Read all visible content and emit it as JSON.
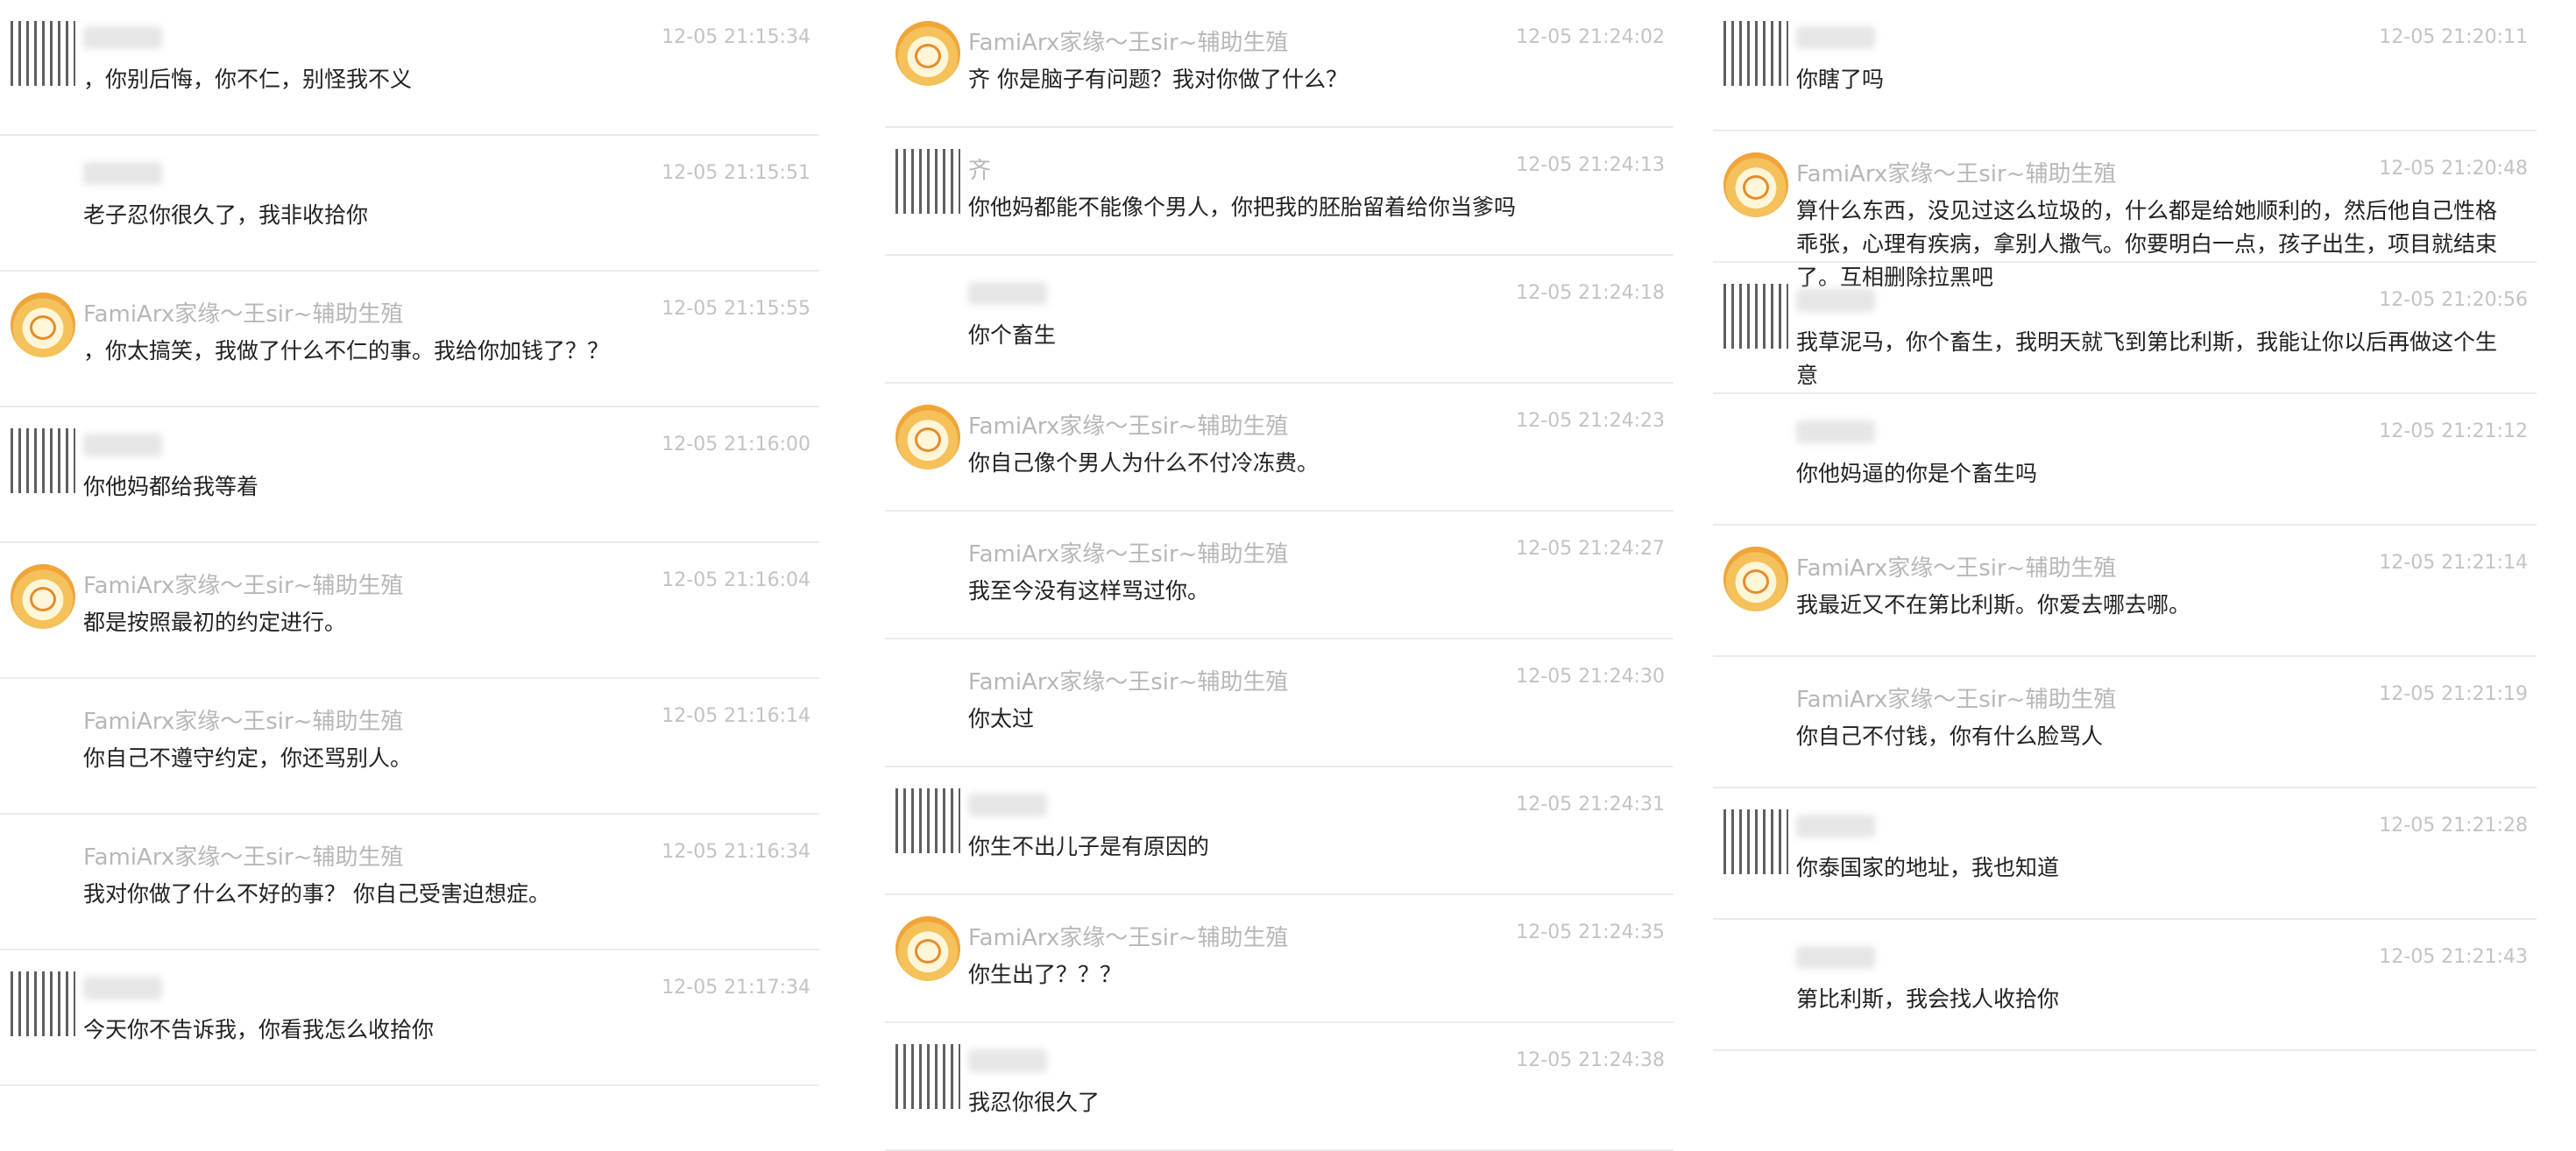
{
  "columns": [
    {
      "messages": [
        {
          "sender": "",
          "time": "12-05 21:15:34",
          "text": "，你别后悔，你不仁，别怪我不义",
          "avatar": "blurred"
        },
        {
          "sender": "",
          "time": "12-05 21:15:51",
          "text": "老子忍你很久了，我非收拾你",
          "avatar": "none"
        },
        {
          "sender": "FamiArx家缘～王sir~辅助生殖",
          "time": "12-05 21:15:55",
          "text": "，你太搞笑，我做了什么不仁的事。我给你加钱了？？",
          "avatar": "default"
        },
        {
          "sender": "",
          "time": "12-05 21:16:00",
          "text": "你他妈都给我等着",
          "avatar": "blurred"
        },
        {
          "sender": "FamiArx家缘～王sir~辅助生殖",
          "time": "12-05 21:16:04",
          "text": "都是按照最初的约定进行。",
          "avatar": "default"
        },
        {
          "sender": "FamiArx家缘～王sir~辅助生殖",
          "time": "12-05 21:16:14",
          "text": "你自己不遵守约定，你还骂别人。",
          "avatar": "none"
        },
        {
          "sender": "FamiArx家缘～王sir~辅助生殖",
          "time": "12-05 21:16:34",
          "text": "我对你做了什么不好的事？ 你自己受害迫想症。",
          "avatar": "none"
        },
        {
          "sender": "",
          "time": "12-05 21:17:34",
          "text": "今天你不告诉我，你看我怎么收拾你",
          "avatar": "blurred"
        }
      ]
    },
    {
      "messages": [
        {
          "sender": "FamiArx家缘～王sir~辅助生殖",
          "time": "12-05 21:24:02",
          "text": "齐 你是脑子有问题？我对你做了什么？",
          "avatar": "default"
        },
        {
          "sender": "齐",
          "time": "12-05 21:24:13",
          "text": "你他妈都能不能像个男人，你把我的胚胎留着给你当爹吗",
          "avatar": "blurred"
        },
        {
          "sender": "",
          "time": "12-05 21:24:18",
          "text": "你个畜生",
          "avatar": "none"
        },
        {
          "sender": "FamiArx家缘～王sir~辅助生殖",
          "time": "12-05 21:24:23",
          "text": "你自己像个男人为什么不付冷冻费。",
          "avatar": "default"
        },
        {
          "sender": "FamiArx家缘～王sir~辅助生殖",
          "time": "12-05 21:24:27",
          "text": "我至今没有这样骂过你。",
          "avatar": "none"
        },
        {
          "sender": "FamiArx家缘～王sir~辅助生殖",
          "time": "12-05 21:24:30",
          "text": "你太过",
          "avatar": "none"
        },
        {
          "sender": "",
          "time": "12-05 21:24:31",
          "text": "你生不出儿子是有原因的",
          "avatar": "blurred"
        },
        {
          "sender": "FamiArx家缘～王sir~辅助生殖",
          "time": "12-05 21:24:35",
          "text": "你生出了？？？",
          "avatar": "default"
        },
        {
          "sender": "",
          "time": "12-05 21:24:38",
          "text": "我忍你很久了",
          "avatar": "blurred"
        }
      ]
    },
    {
      "messages": [
        {
          "sender": "",
          "time": "12-05 21:20:11",
          "text": "你瞎了吗",
          "avatar": "blurred"
        },
        {
          "sender": "FamiArx家缘～王sir~辅助生殖",
          "time": "12-05 21:20:48",
          "text": "算什么东西，没见过这么垃圾的，什么都是给她顺利的，然后他自己性格乖张，心理有疾病，拿别人撒气。你要明白一点，孩子出生，项目就结束了。互相删除拉黑吧",
          "avatar": "default"
        },
        {
          "sender": "",
          "time": "12-05 21:20:56",
          "text": "我草泥马，你个畜生，我明天就飞到第比利斯，我能让你以后再做这个生意",
          "avatar": "blurred"
        },
        {
          "sender": "",
          "time": "12-05 21:21:12",
          "text": "你他妈逼的你是个畜生吗",
          "avatar": "none"
        },
        {
          "sender": "FamiArx家缘～王sir~辅助生殖",
          "time": "12-05 21:21:14",
          "text": "我最近又不在第比利斯。你爱去哪去哪。",
          "avatar": "default"
        },
        {
          "sender": "FamiArx家缘～王sir~辅助生殖",
          "time": "12-05 21:21:19",
          "text": "你自己不付钱，你有什么脸骂人",
          "avatar": "none"
        },
        {
          "sender": "",
          "time": "12-05 21:21:28",
          "text": "你泰国家的地址，我也知道",
          "avatar": "blurred"
        },
        {
          "sender": "",
          "time": "12-05 21:21:43",
          "text": "第比利斯，我会找人收拾你",
          "avatar": "none"
        }
      ]
    }
  ]
}
